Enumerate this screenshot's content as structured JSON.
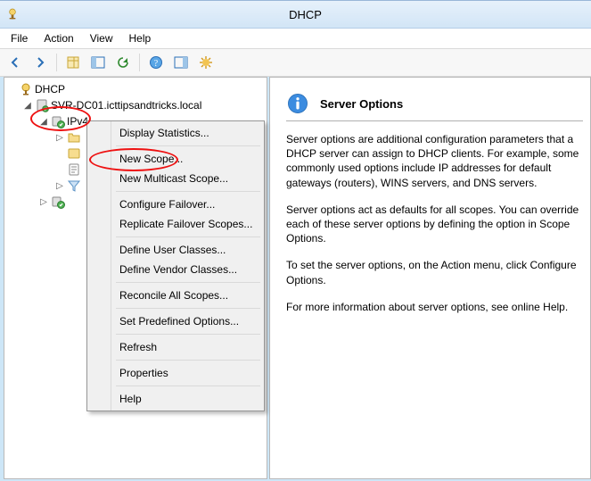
{
  "title": "DHCP",
  "menubar": {
    "file": "File",
    "action": "Action",
    "view": "View",
    "help": "Help"
  },
  "tree": {
    "root": "DHCP",
    "server": "SVR-DC01.icttipsandtricks.local",
    "ipv4": "IPv4"
  },
  "context_menu": {
    "display_statistics": "Display Statistics...",
    "new_scope": "New Scope...",
    "new_multicast_scope": "New Multicast Scope...",
    "configure_failover": "Configure Failover...",
    "replicate_failover": "Replicate Failover Scopes...",
    "define_user_classes": "Define User Classes...",
    "define_vendor_classes": "Define Vendor Classes...",
    "reconcile": "Reconcile All Scopes...",
    "set_predefined": "Set Predefined Options...",
    "refresh": "Refresh",
    "properties": "Properties",
    "help": "Help"
  },
  "content": {
    "heading": "Server Options",
    "p1": "Server options are additional configuration parameters that a DHCP server can assign to DHCP clients. For example, some commonly used options include IP addresses for default gateways (routers), WINS servers, and DNS servers.",
    "p2": "Server options act as defaults for all scopes.  You can override each of these server options by defining the option in Scope Options.",
    "p3": "To set the server options, on the Action menu, click Configure Options.",
    "p4": "For more information about server options, see online Help."
  }
}
